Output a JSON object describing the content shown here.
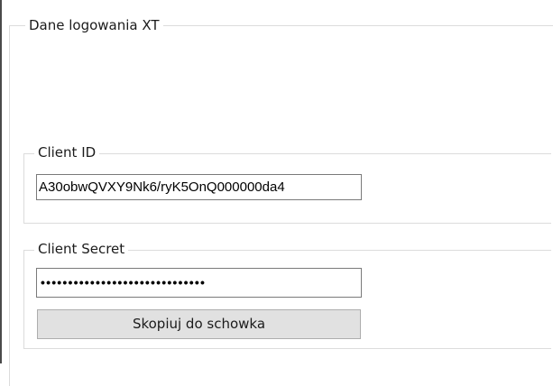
{
  "outer_group": {
    "title": "Dane logowania XT"
  },
  "client_id_group": {
    "title": "Client ID",
    "value": "A30obwQVXY9Nk6/ryK5OnQ000000da4"
  },
  "client_secret_group": {
    "title": "Client Secret",
    "masked_value": "••••••••••••••••••••••••••••••",
    "copy_button_label": "Skopiuj do schowka"
  }
}
